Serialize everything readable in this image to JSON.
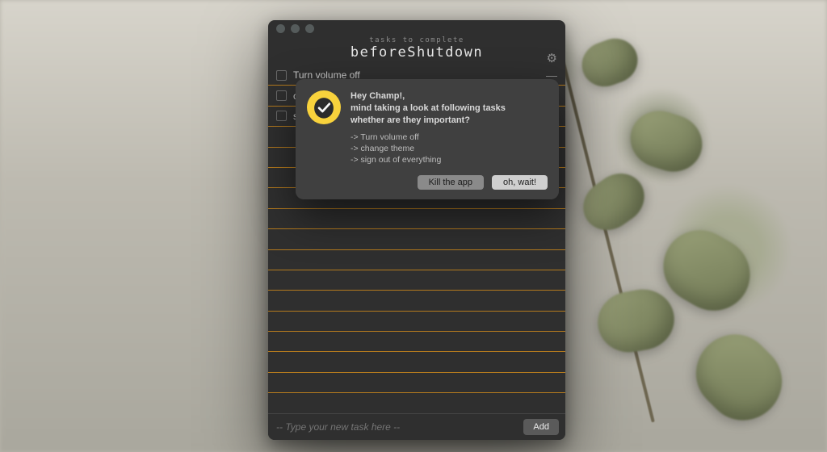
{
  "header": {
    "subtitle": "tasks to complete",
    "title": "beforeShutdown"
  },
  "rows": [
    {
      "label": "Turn volume off"
    },
    {
      "label": "change theme"
    },
    {
      "label": "sign out of everything"
    }
  ],
  "total_rows": 17,
  "input": {
    "placeholder": "-- Type your new task here --",
    "add_label": "Add"
  },
  "dialog": {
    "greeting": "Hey Champ!,",
    "line1": "mind taking a look at following tasks",
    "line2": "whether are they important?",
    "tasks": [
      "-> Turn volume off",
      "-> change theme",
      "-> sign out of everything"
    ],
    "secondary_label": "Kill the app",
    "primary_label": "oh, wait!"
  },
  "colors": {
    "accent": "#f8d23c",
    "rule": "#b47a1e",
    "window_bg": "#2f2f2f",
    "dialog_bg": "#404040"
  }
}
